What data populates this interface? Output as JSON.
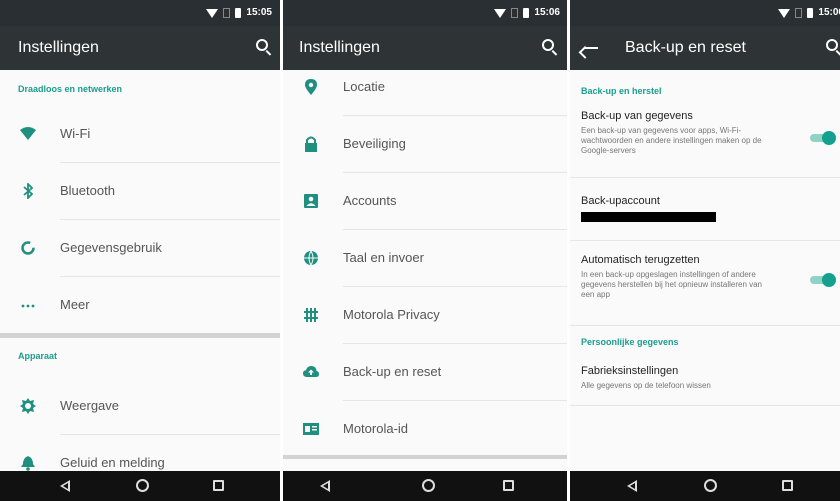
{
  "status_bar": {
    "left_time": "15:05",
    "middle_time": "15:06",
    "right_time": "15:06"
  },
  "screen1": {
    "title": "Instellingen",
    "section_wireless": "Draadloos en netwerken",
    "items": [
      {
        "label": "Wi-Fi",
        "icon": "wifi-icon"
      },
      {
        "label": "Bluetooth",
        "icon": "bluetooth-icon"
      },
      {
        "label": "Gegevensgebruik",
        "icon": "data-usage-icon"
      },
      {
        "label": "Meer",
        "icon": "more-icon"
      }
    ],
    "section_device": "Apparaat",
    "device_items": [
      {
        "label": "Weergave",
        "icon": "brightness-icon"
      },
      {
        "label": "Geluid en melding",
        "icon": "bell-icon"
      }
    ]
  },
  "screen2": {
    "title": "Instellingen",
    "items": [
      {
        "label": "Locatie",
        "icon": "location-icon"
      },
      {
        "label": "Beveiliging",
        "icon": "lock-icon"
      },
      {
        "label": "Accounts",
        "icon": "account-icon"
      },
      {
        "label": "Taal en invoer",
        "icon": "globe-icon"
      },
      {
        "label": "Motorola Privacy",
        "icon": "privacy-grid-icon"
      },
      {
        "label": "Back-up en reset",
        "icon": "cloud-upload-icon"
      },
      {
        "label": "Motorola-id",
        "icon": "id-card-icon"
      }
    ]
  },
  "screen3": {
    "title": "Back-up en reset",
    "section_backup": "Back-up en herstel",
    "backup_data": {
      "title": "Back-up van gegevens",
      "desc": "Een back-up van gegevens voor apps, Wi-Fi-wachtwoorden en andere instellingen maken op de Google-servers",
      "enabled": true
    },
    "backup_account": {
      "title": "Back-upaccount"
    },
    "auto_restore": {
      "title": "Automatisch terugzetten",
      "desc": "In een back-up opgeslagen instellingen of andere gegevens herstellen bij het opnieuw installeren van een app",
      "enabled": true
    },
    "section_personal": "Persoonlijke gegevens",
    "factory_reset": {
      "title": "Fabrieksinstellingen",
      "desc": "Alle gegevens op de telefoon wissen"
    }
  },
  "colors": {
    "accent": "#1a9e8f",
    "appbar": "#2e3336",
    "statusbar": "#2a2f33",
    "navbar": "#111111"
  }
}
